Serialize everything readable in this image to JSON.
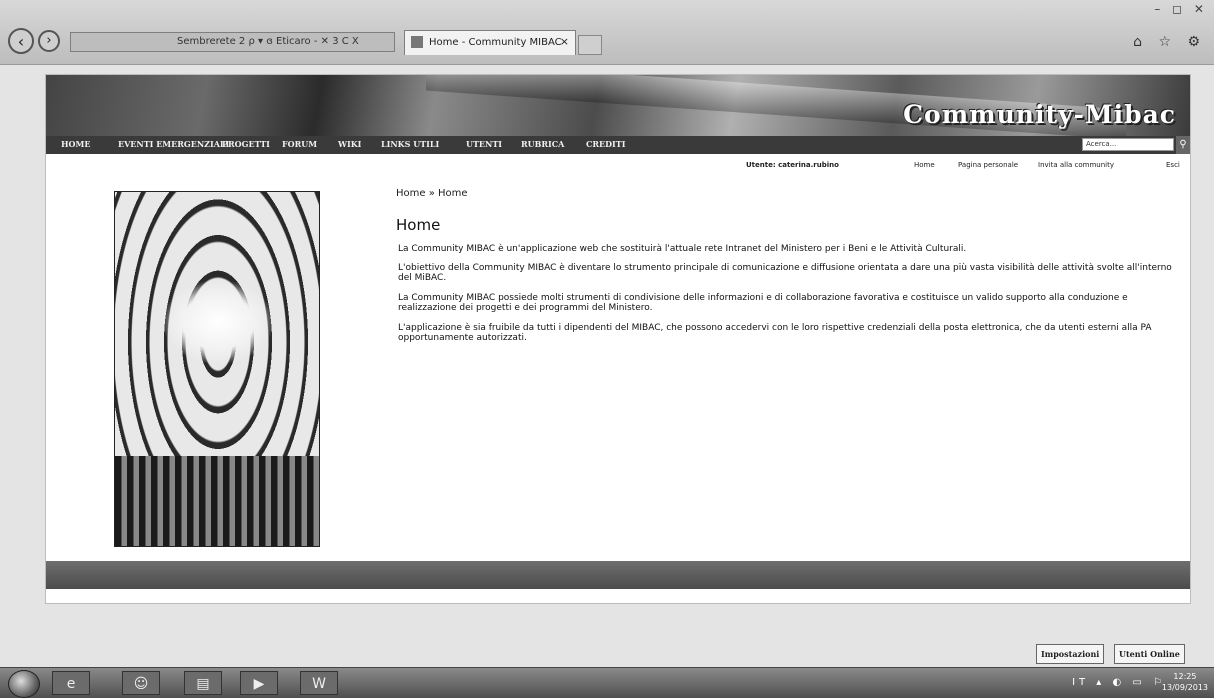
{
  "browser": {
    "address_text": "Sembrerete 2 ρ ▾ ɞ Eticaro - ✕ 3 C X",
    "tab_title": "Home - Community MIBAC",
    "tab_close": "×",
    "back_icon": "arrow-left-icon",
    "forward_icon": "arrow-right-icon",
    "window_controls": "– ◻ ✕",
    "tools": "⌂ ☆ ⚙"
  },
  "banner": {
    "title": "Community-Mibac"
  },
  "menu": {
    "items": [
      "HOME",
      "EVENTI EMERGENZIALI",
      "PROGETTI",
      "FORUM",
      "WIKI",
      "LINKS UTILI",
      "UTENTI",
      "RUBRICA",
      "CREDITI"
    ],
    "search_placeholder": "Acerca..."
  },
  "userbar": {
    "user_label": "Utente: caterina.rubino",
    "links": [
      "Home",
      "Pagina personale",
      "Invita alla community",
      "Esci"
    ]
  },
  "content": {
    "breadcrumb": "Home » Home",
    "title": "Home",
    "paragraphs": [
      "La Community MIBAC è un'applicazione web che sostituirà l'attuale rete Intranet del Ministero per i Beni e le Attività Culturali.",
      "L'obiettivo della Community MIBAC è diventare lo strumento principale di comunicazione e diffusione orientata a dare una più vasta visibilità delle attività svolte all'interno del MiBAC.",
      "La Community MIBAC possiede molti strumenti di condivisione delle informazioni e di collaborazione favorativa e costituisce un valido supporto alla conduzione e realizzazione dei progetti e dei programmi del Ministero.",
      "L'applicazione è sia fruibile da tutti i dipendenti del MIBAC, che possono accedervi con le loro rispettive credenziali della posta elettronica, che da utenti esterni alla PA opportunamente autorizzati."
    ]
  },
  "bottom_tabs": [
    "Impostazioni",
    "Utenti Online"
  ],
  "taskbar": {
    "tray_text": "IT ▴ ◐ ▭ ⚐",
    "time": "12:25",
    "date": "13/09/2013"
  }
}
